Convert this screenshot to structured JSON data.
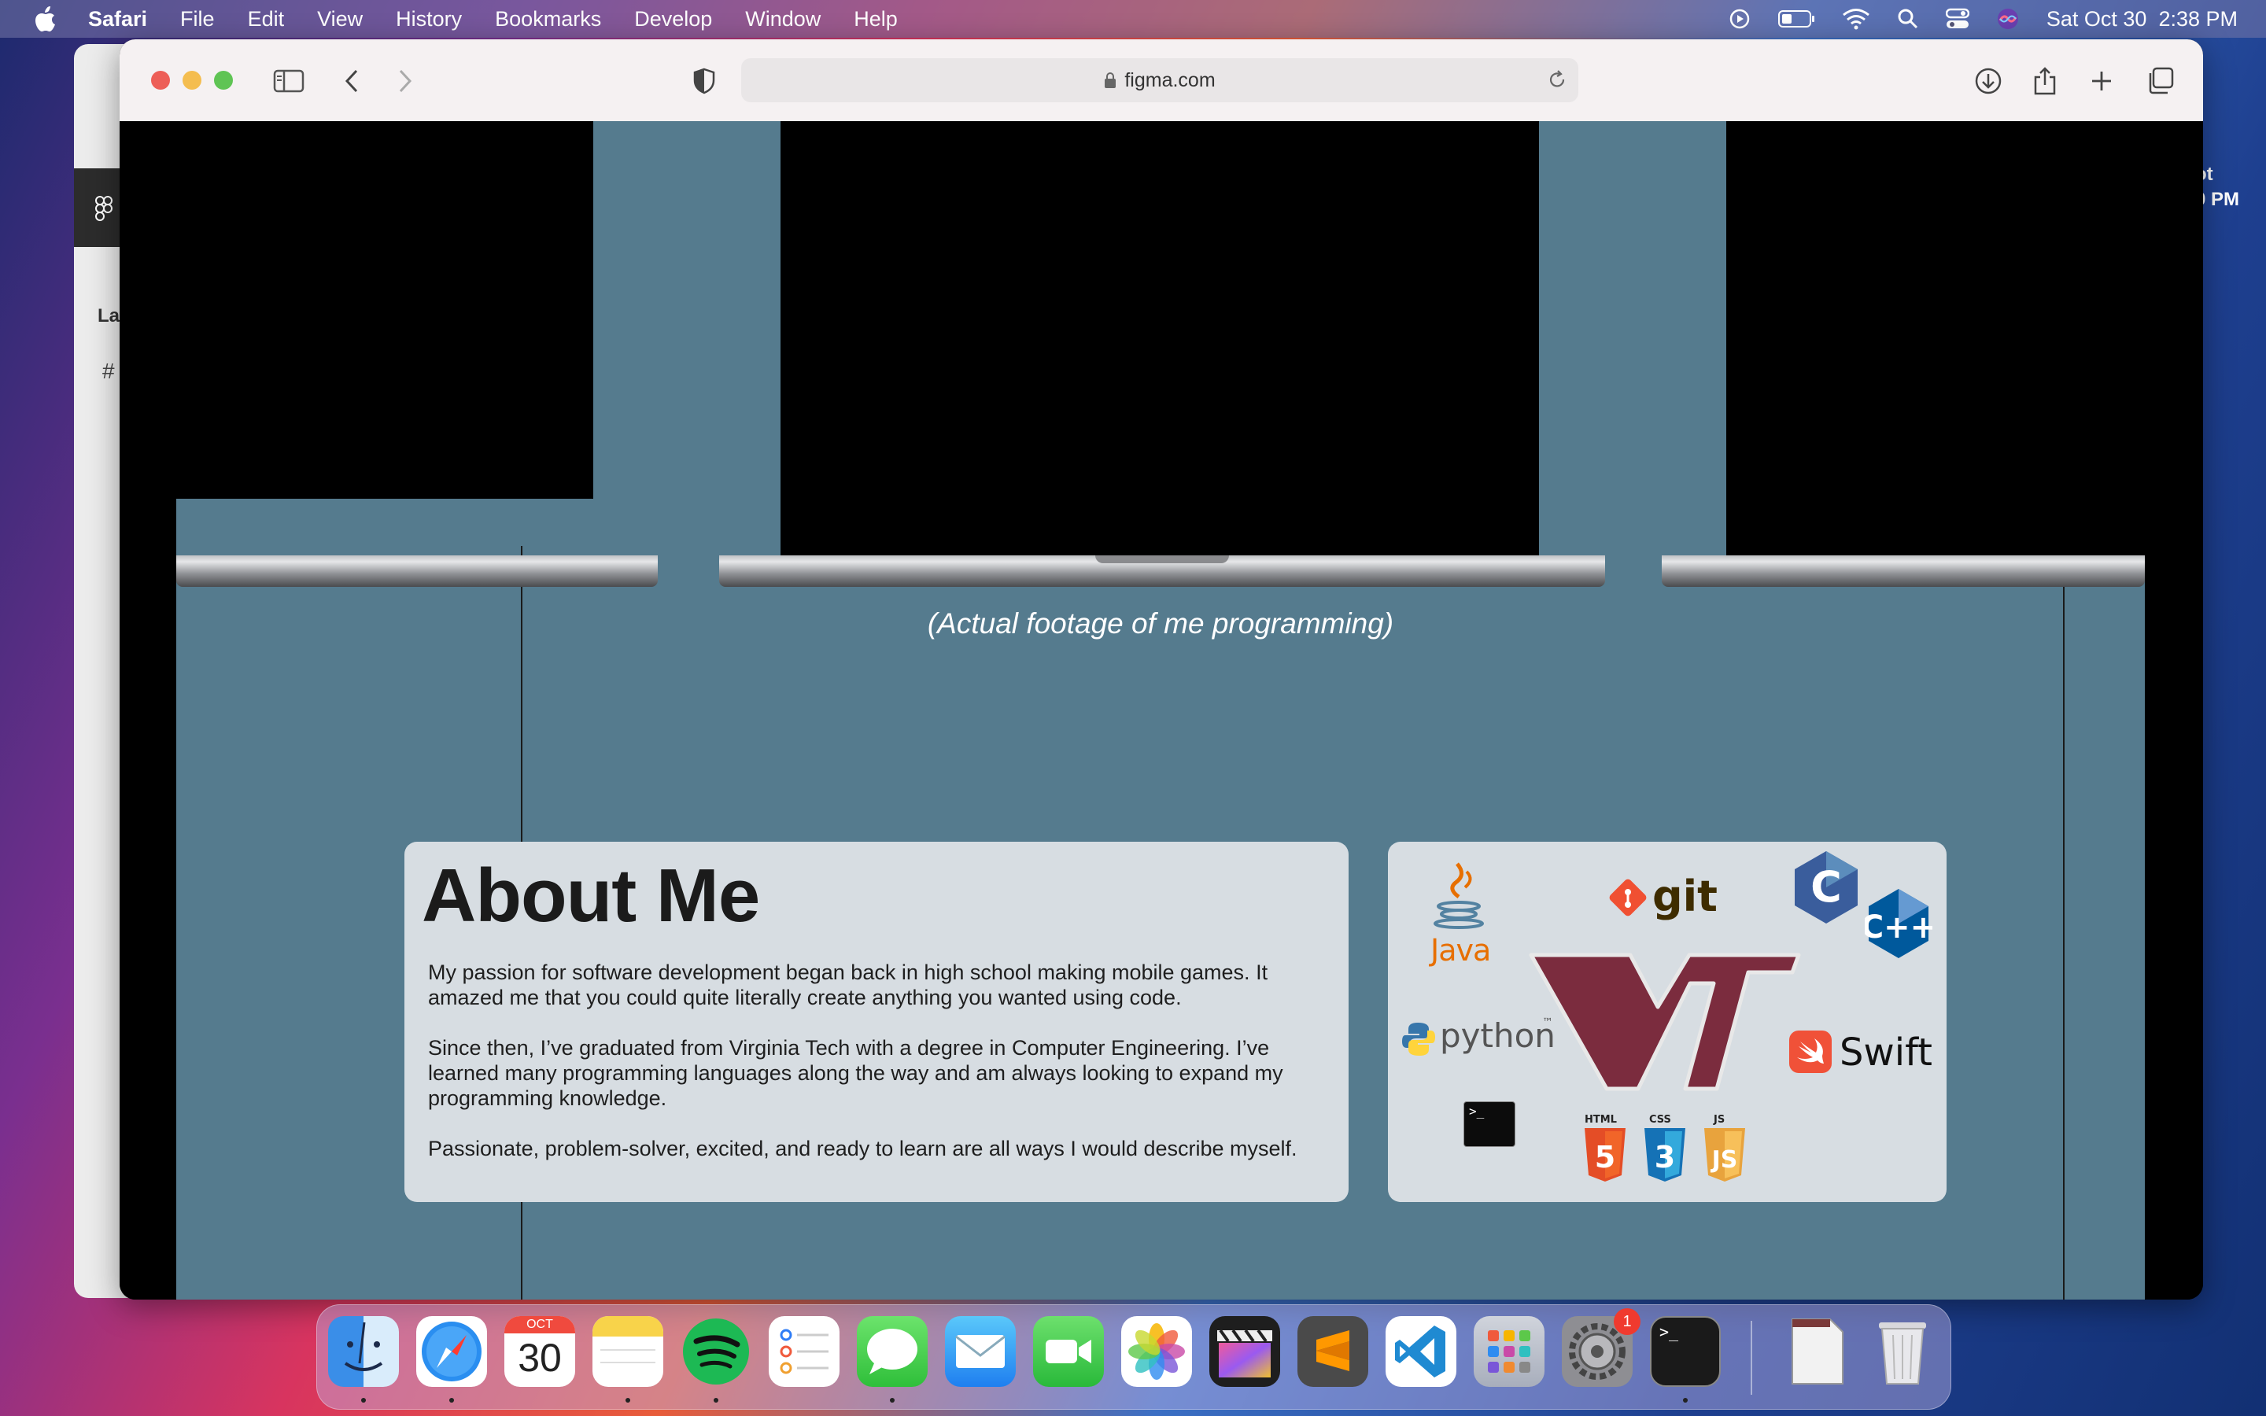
{
  "menubar": {
    "app_name": "Safari",
    "items": [
      "File",
      "Edit",
      "View",
      "History",
      "Bookmarks",
      "Develop",
      "Window",
      "Help"
    ],
    "datetime": "Sat Oct 30  2:38 PM"
  },
  "desktop": {
    "right_label_1": "ot",
    "right_label_2": "0 PM"
  },
  "background_window": {
    "sidebar_text": "La",
    "hash": "#"
  },
  "browser": {
    "url": "figma.com"
  },
  "page": {
    "caption": "(Actual footage of me programming)",
    "about": {
      "title": "About Me",
      "paragraph_1_line_1": "My passion for software development began back in high school making mobile games. It",
      "paragraph_1_line_2": "amazed me that you could quite literally create anything you wanted using code.",
      "paragraph_2_line_1": "Since then, I’ve graduated from Virginia Tech with a degree in Computer Engineering. I’ve",
      "paragraph_2_line_2": "learned many programming languages along the way and am always looking to expand my",
      "paragraph_2_line_3": "programming knowledge.",
      "paragraph_3": "Passionate, problem-solver, excited, and ready to learn are all ways I would describe myself."
    },
    "skills": {
      "java": "Java",
      "git": "git",
      "c": "C",
      "cpp": "C++",
      "python": "python",
      "python_tm": "™",
      "vt": "VT",
      "swift": "Swift",
      "terminal": ">_",
      "html": "HTML",
      "css": "CSS",
      "js": "JS",
      "html_num": "5",
      "css_num": "3",
      "js_num": "JS",
      "colors": {
        "vt_maroon": "#7b2c3e",
        "vt_orange": "#e87722",
        "html": "#e44d26",
        "css": "#1572b6",
        "js": "#f0a030",
        "swift": "#f05138",
        "c": "#3a5d9c",
        "git": "#f05032"
      }
    }
  },
  "dock": {
    "calendar_month": "OCT",
    "calendar_day": "30",
    "settings_badge": "1",
    "apps": [
      "finder",
      "safari",
      "calendar",
      "notes",
      "spotify",
      "reminders",
      "messages",
      "mail",
      "facetime",
      "photos",
      "final-cut-pro",
      "sublime-text",
      "vscode",
      "launchpad",
      "system-preferences",
      "terminal",
      "document",
      "trash"
    ]
  }
}
